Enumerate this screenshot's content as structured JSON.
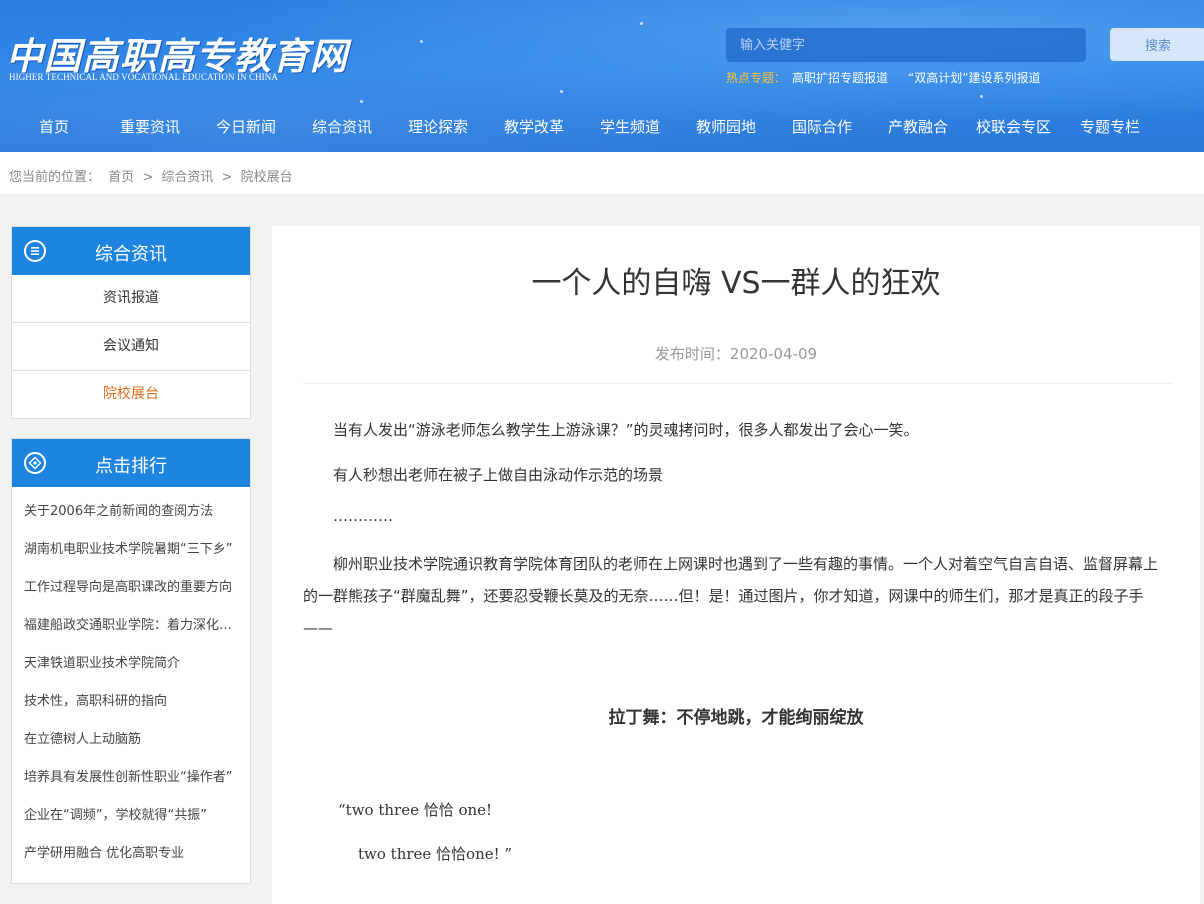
{
  "header": {
    "logo_cn": "中国高职高专教育网",
    "logo_en": "HIGHER TECHNICAL AND VOCATIONAL EDUCATION IN CHINA",
    "search_placeholder": "输入关健字",
    "search_button": "搜索",
    "hot_label": "热点专题：",
    "hot_links": [
      "高职扩招专题报道",
      "“双高计划”建设系列报道"
    ]
  },
  "nav": [
    "首页",
    "重要资讯",
    "今日新闻",
    "综合资讯",
    "理论探索",
    "教学改革",
    "学生频道",
    "教师园地",
    "国际合作",
    "产教融合",
    "校联会专区",
    "专题专栏"
  ],
  "breadcrumb": {
    "prefix": "您当前的位置：",
    "items": [
      "首页",
      ">",
      "综合资讯",
      ">",
      "院校展台"
    ]
  },
  "sidebar": {
    "category_title": "综合资讯",
    "category_items": [
      {
        "label": "资讯报道",
        "active": false
      },
      {
        "label": "会议通知",
        "active": false
      },
      {
        "label": "院校展台",
        "active": true
      }
    ],
    "ranking_title": "点击排行",
    "ranking_items": [
      "关于2006年之前新闻的查阅方法",
      "湖南机电职业技术学院暑期“三下乡”",
      "工作过程导向是高职课改的重要方向",
      "福建船政交通职业学院：着力深化改革",
      "天津铁道职业技术学院简介",
      "技术性，高职科研的指向",
      "在立德树人上动脑筋",
      "培养具有发展性创新性职业“操作者”",
      "企业在“调频”，学校就得“共振”",
      "产学研用融合 优化高职专业"
    ]
  },
  "article": {
    "title": "一个人的自嗨 VS一群人的狂欢",
    "publish": "发布时间：2020-04-09",
    "p1": "当有人发出“游泳老师怎么教学生上游泳课？”的灵魂拷问时，很多人都发出了会心一笑。",
    "p2": "有人秒想出老师在被子上做自由泳动作示范的场景",
    "p3": "…………",
    "p4": "柳州职业技术学院通识教育学院体育团队的老师在上网课时也遇到了一些有趣的事情。一个人对着空气自言自语、监督屏幕上的一群熊孩子“群魔乱舞”，还要忍受鞭长莫及的无奈……但！是！通过图片，你才知道，网课中的师生们，那才是真正的段子手——",
    "subhead": "拉丁舞：不停地跳，才能绚丽绽放",
    "quote1": "“two three 恰恰 one!",
    "quote2": "two three 恰恰one! ”"
  }
}
